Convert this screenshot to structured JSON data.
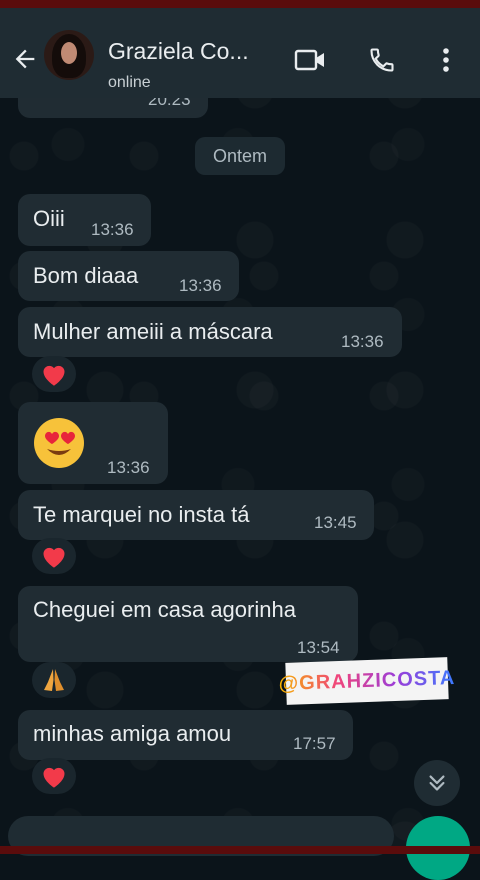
{
  "header": {
    "contact_name": "Graziela Co...",
    "status": "online"
  },
  "partial_top_time": "20:23",
  "date_separator": "Ontem",
  "messages": [
    {
      "text": "Oiii",
      "time": "13:36"
    },
    {
      "text": "Bom diaaa",
      "time": "13:36"
    },
    {
      "text": "Mulher ameiii a máscara",
      "time": "13:36",
      "reaction": "heart"
    },
    {
      "emoji": "heart-eyes",
      "time": "13:36"
    },
    {
      "text": "Te marquei no insta tá",
      "time": "13:45",
      "reaction": "heart"
    },
    {
      "text": "Cheguei em casa agorinha",
      "time": "13:54",
      "reaction": "folded-hands"
    },
    {
      "text": "minhas amiga amou",
      "time": "17:57",
      "reaction": "heart"
    }
  ],
  "watermark": "@GRAHZICOSTA",
  "colors": {
    "background": "#0b141a",
    "header": "#1f2c33",
    "bubble": "#202c33",
    "accent": "#00a884"
  },
  "icons": {
    "back": "arrow-left-icon",
    "video": "video-camera-icon",
    "call": "phone-icon",
    "menu": "more-vertical-icon",
    "scroll": "double-chevron-down-icon"
  }
}
